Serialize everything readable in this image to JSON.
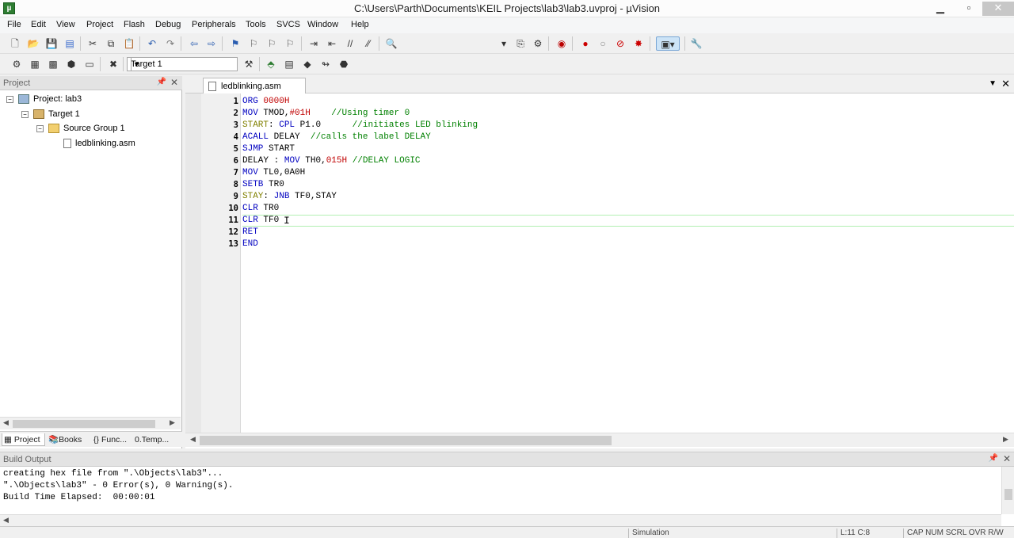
{
  "window": {
    "title": "C:\\Users\\Parth\\Documents\\KEIL Projects\\lab3\\lab3.uvproj - µVision",
    "minimize": "▁",
    "maximize": "▫",
    "close": "✕"
  },
  "menu": [
    "File",
    "Edit",
    "View",
    "Project",
    "Flash",
    "Debug",
    "Peripherals",
    "Tools",
    "SVCS",
    "Window",
    "Help"
  ],
  "toolbar": {
    "target_select": "Target 1"
  },
  "project_pane": {
    "title": "Project",
    "tree": [
      {
        "label": "Project: lab3",
        "icon": "project-icon"
      },
      {
        "label": "Target 1",
        "icon": "target-icon"
      },
      {
        "label": "Source Group 1",
        "icon": "folder-icon"
      },
      {
        "label": "ledblinking.asm",
        "icon": "file-icon"
      }
    ],
    "tabs": [
      "Project",
      "Books",
      "Func...",
      "Temp..."
    ]
  },
  "editor": {
    "tab_label": "ledblinking.asm",
    "line_numbers": [
      "1",
      "2",
      "3",
      "4",
      "5",
      "6",
      "7",
      "8",
      "9",
      "10",
      "11",
      "12",
      "13"
    ],
    "lines": [
      "ORG 0000H",
      "MOV TMOD,#01H    //Using timer 0",
      "START: CPL P1.0      //initiates LED blinking",
      "ACALL DELAY  //calls the label DELAY",
      "SJMP START",
      "DELAY : MOV TH0,015H //DELAY LOGIC",
      "MOV TL0,0A0H",
      "SETB TR0",
      "STAY: JNB TF0,STAY",
      "CLR TR0",
      "CLR TF0",
      "RET",
      "END"
    ],
    "current_line": 11
  },
  "build_output": {
    "title": "Build Output",
    "lines": [
      "creating hex file from \".\\Objects\\lab3\"...",
      "\".\\Objects\\lab3\" - 0 Error(s), 0 Warning(s).",
      "Build Time Elapsed:  00:00:01"
    ]
  },
  "status": {
    "mode": "Simulation",
    "position": "L:11 C:8",
    "flags": "CAP  NUM  SCRL  OVR  R/W"
  }
}
